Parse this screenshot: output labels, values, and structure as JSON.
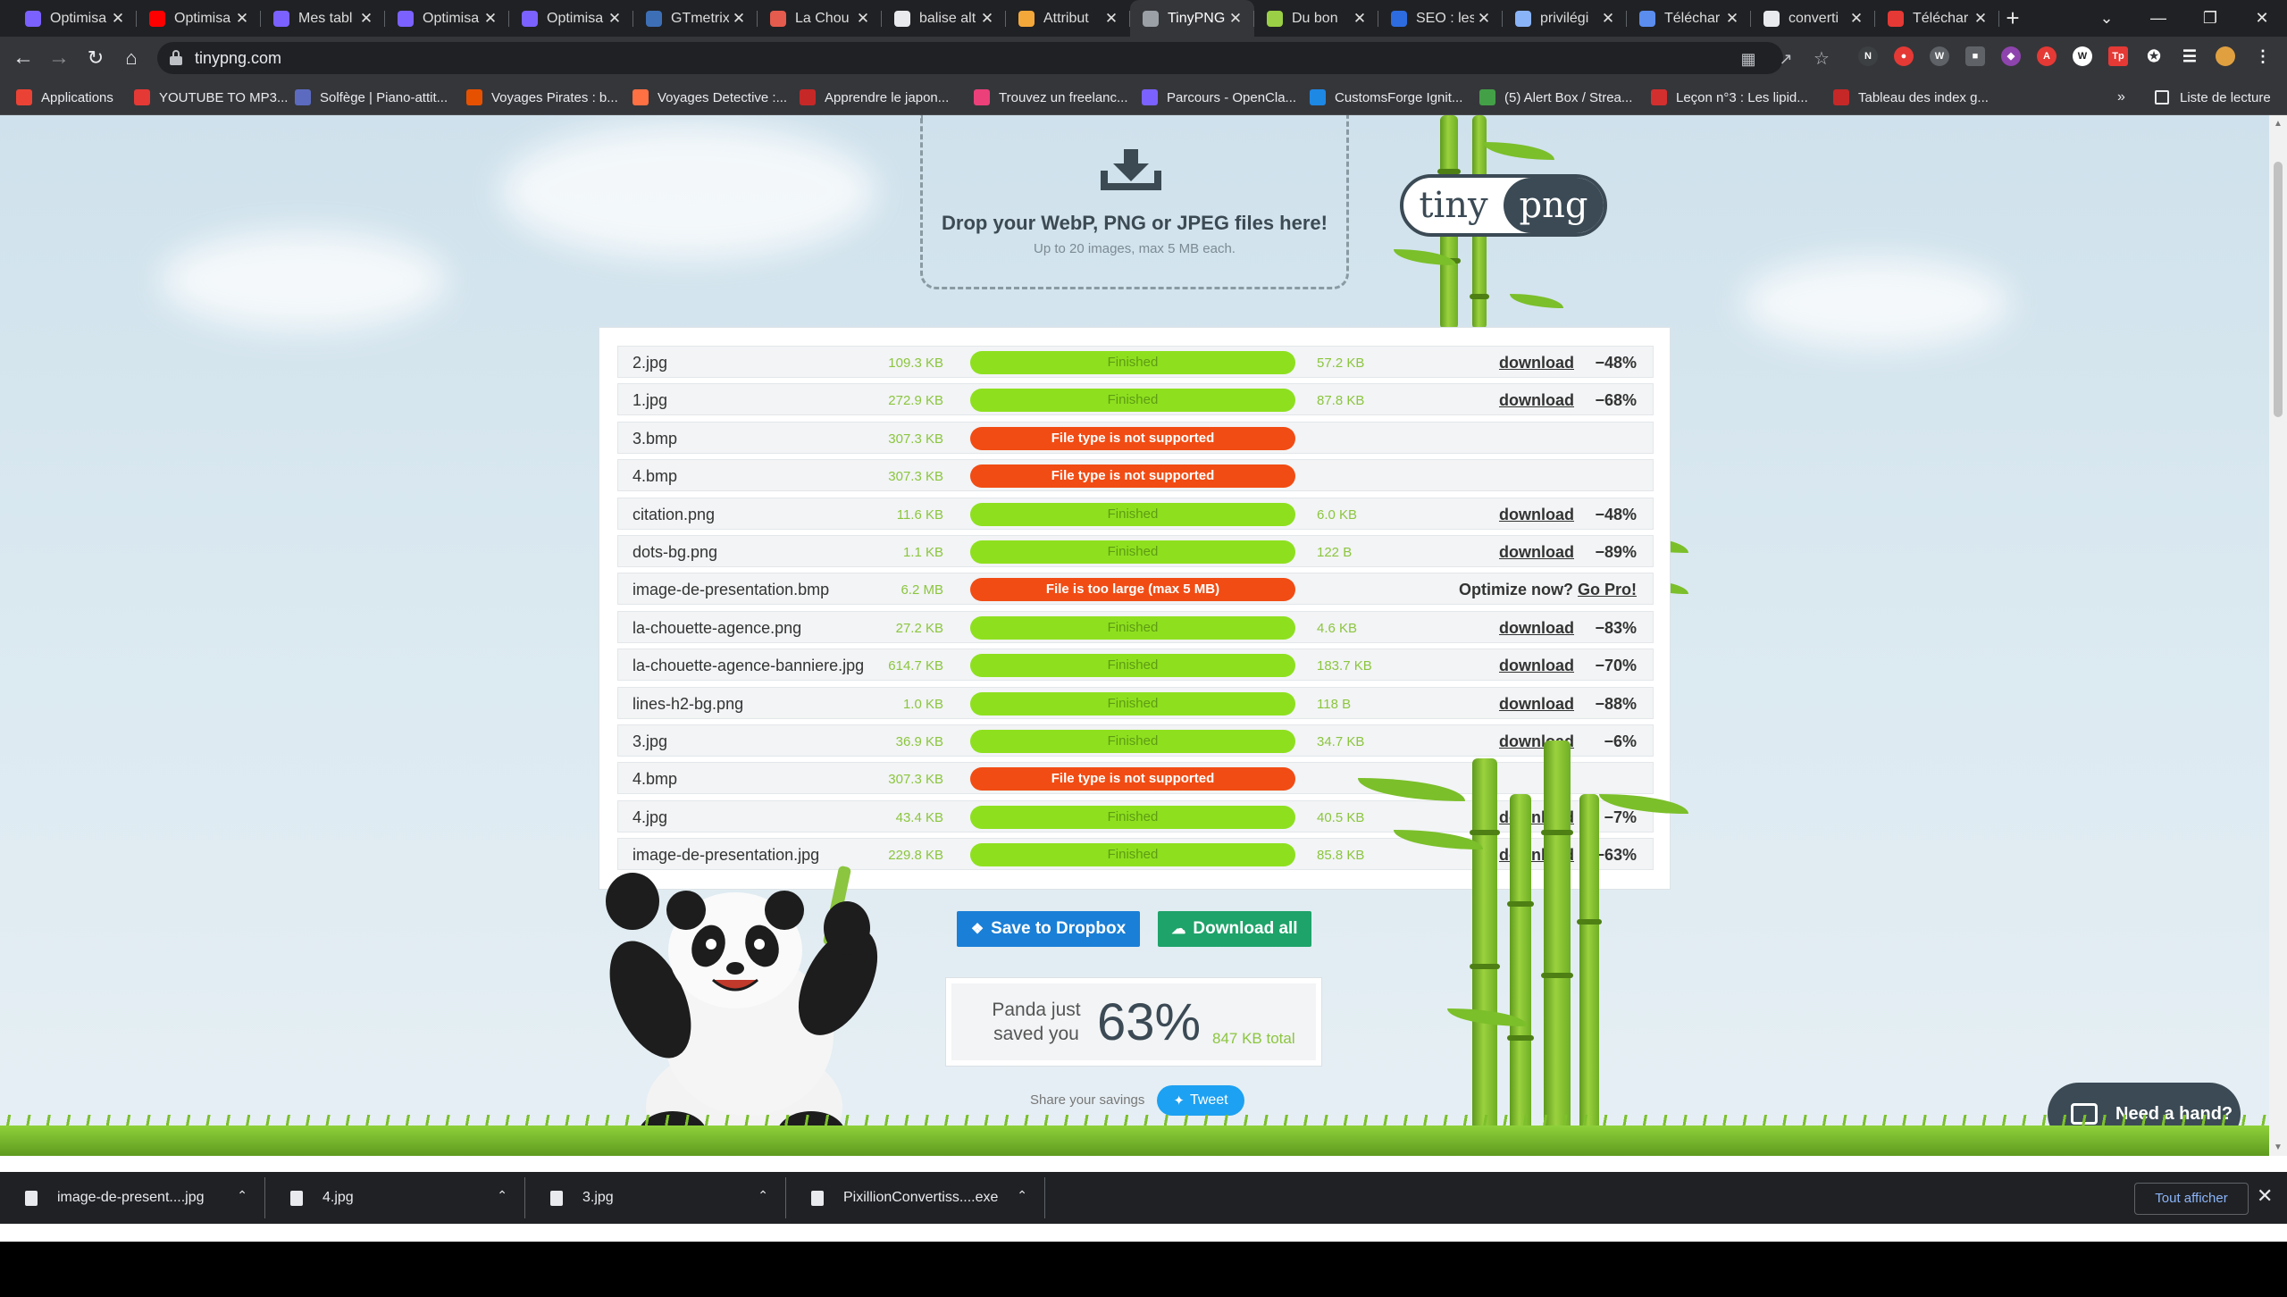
{
  "browser": {
    "tabs": [
      {
        "title": "Optimisa",
        "fav": "#7b61ff"
      },
      {
        "title": "Optimisa",
        "fav": "#ff0000"
      },
      {
        "title": "Mes tabl",
        "fav": "#7b61ff"
      },
      {
        "title": "Optimisa",
        "fav": "#7b61ff"
      },
      {
        "title": "Optimisa",
        "fav": "#7b61ff"
      },
      {
        "title": "GTmetrix",
        "fav": "#3d6fb6"
      },
      {
        "title": "La Chou",
        "fav": "#e55b4d"
      },
      {
        "title": "balise alt",
        "fav": "#e8eaed"
      },
      {
        "title": "Attribut",
        "fav": "#f4a83a"
      },
      {
        "title": "TinyPNG",
        "fav": "#9aa0a6"
      },
      {
        "title": "Du bon",
        "fav": "#9bcf45"
      },
      {
        "title": "SEO : les",
        "fav": "#2d6ce0"
      },
      {
        "title": "privilégi",
        "fav": "#8ab4f8"
      },
      {
        "title": "Téléchar",
        "fav": "#5b8def"
      },
      {
        "title": "converti",
        "fav": "#e8eaed"
      },
      {
        "title": "Téléchar",
        "fav": "#e53935"
      }
    ],
    "url": "tinypng.com",
    "bookmarks": [
      {
        "label": "Applications",
        "fav": "#ea4335"
      },
      {
        "label": "YOUTUBE TO MP3...",
        "fav": "#e53935"
      },
      {
        "label": "Solfège | Piano-attit...",
        "fav": "#5c6bc0"
      },
      {
        "label": "Voyages Pirates : b...",
        "fav": "#e65100"
      },
      {
        "label": "Voyages Detective :...",
        "fav": "#ff7043"
      },
      {
        "label": "Apprendre le japon...",
        "fav": "#c62828"
      },
      {
        "label": "Trouvez un freelanc...",
        "fav": "#ec407a"
      },
      {
        "label": "Parcours - OpenCla...",
        "fav": "#7b61ff"
      },
      {
        "label": "CustomsForge Ignit...",
        "fav": "#1e88e5"
      },
      {
        "label": "(5) Alert Box / Strea...",
        "fav": "#43a047"
      },
      {
        "label": "Leçon n°3 : Les lipid...",
        "fav": "#d32f2f"
      },
      {
        "label": "Tableau des index g...",
        "fav": "#c62828"
      }
    ],
    "more": "»",
    "reading_list": "Liste de lecture"
  },
  "drop": {
    "title": "Drop your WebP, PNG or JPEG files here!",
    "subtitle": "Up to 20 images, max 5 MB each."
  },
  "logo": {
    "left": "tiny",
    "right": "png"
  },
  "files": [
    {
      "name": "2.jpg",
      "size": "109.3 KB",
      "status": "Finished",
      "ok": true,
      "new_size": "57.2 KB",
      "action": "download",
      "saving": "−48%"
    },
    {
      "name": "1.jpg",
      "size": "272.9 KB",
      "status": "Finished",
      "ok": true,
      "new_size": "87.8 KB",
      "action": "download",
      "saving": "−68%"
    },
    {
      "name": "3.bmp",
      "size": "307.3 KB",
      "status": "File type is not supported",
      "ok": false,
      "new_size": "",
      "action": "",
      "saving": ""
    },
    {
      "name": "4.bmp",
      "size": "307.3 KB",
      "status": "File type is not supported",
      "ok": false,
      "new_size": "",
      "action": "",
      "saving": ""
    },
    {
      "name": "citation.png",
      "size": "11.6 KB",
      "status": "Finished",
      "ok": true,
      "new_size": "6.0 KB",
      "action": "download",
      "saving": "−48%"
    },
    {
      "name": "dots-bg.png",
      "size": "1.1 KB",
      "status": "Finished",
      "ok": true,
      "new_size": "122 B",
      "action": "download",
      "saving": "−89%"
    },
    {
      "name": "image-de-presentation.bmp",
      "size": "6.2 MB",
      "status": "File is too large (max 5 MB)",
      "ok": false,
      "new_size": "",
      "action": "",
      "saving": "",
      "pro_text": "Optimize now?",
      "pro_link": "Go Pro!"
    },
    {
      "name": "la-chouette-agence.png",
      "size": "27.2 KB",
      "status": "Finished",
      "ok": true,
      "new_size": "4.6 KB",
      "action": "download",
      "saving": "−83%"
    },
    {
      "name": "la-chouette-agence-banniere.jpg",
      "size": "614.7 KB",
      "status": "Finished",
      "ok": true,
      "new_size": "183.7 KB",
      "action": "download",
      "saving": "−70%"
    },
    {
      "name": "lines-h2-bg.png",
      "size": "1.0 KB",
      "status": "Finished",
      "ok": true,
      "new_size": "118 B",
      "action": "download",
      "saving": "−88%"
    },
    {
      "name": "3.jpg",
      "size": "36.9 KB",
      "status": "Finished",
      "ok": true,
      "new_size": "34.7 KB",
      "action": "download",
      "saving": "−6%"
    },
    {
      "name": "4.bmp",
      "size": "307.3 KB",
      "status": "File type is not supported",
      "ok": false,
      "new_size": "",
      "action": "",
      "saving": ""
    },
    {
      "name": "4.jpg",
      "size": "43.4 KB",
      "status": "Finished",
      "ok": true,
      "new_size": "40.5 KB",
      "action": "download",
      "saving": "−7%"
    },
    {
      "name": "image-de-presentation.jpg",
      "size": "229.8 KB",
      "status": "Finished",
      "ok": true,
      "new_size": "85.8 KB",
      "action": "download",
      "saving": "−63%"
    }
  ],
  "actions": {
    "dropbox": "Save to Dropbox",
    "download_all": "Download all"
  },
  "savings": {
    "label": "Panda just saved you",
    "label_1": "Panda just",
    "label_2": "saved you",
    "percent": "63%",
    "total": "847 KB total"
  },
  "share": {
    "label": "Share your savings",
    "tweet": "Tweet"
  },
  "help": {
    "label": "Need a hand?"
  },
  "downloads": [
    {
      "name": "image-de-present....jpg"
    },
    {
      "name": "4.jpg"
    },
    {
      "name": "3.jpg"
    },
    {
      "name": "PixillionConvertiss....exe"
    }
  ],
  "show_all": "Tout afficher",
  "colors": {
    "ok": "#8ee01f",
    "error": "#f14c14",
    "dropbox": "#1a7fd6",
    "download_all": "#1ea36a",
    "tweet": "#1da1f2"
  }
}
